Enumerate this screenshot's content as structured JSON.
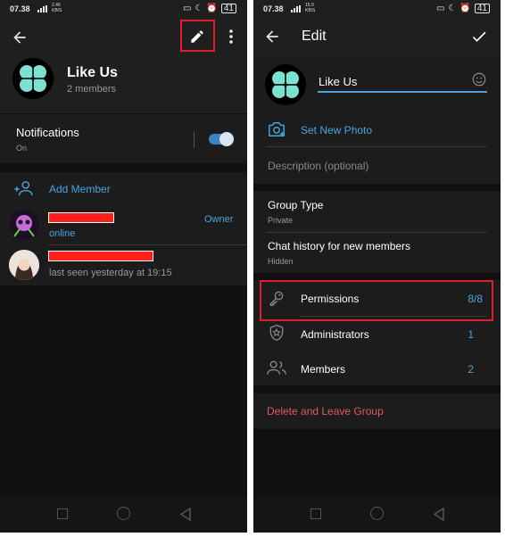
{
  "status": {
    "time": "07.38",
    "network_speed_top": "2.46",
    "network_speed_bottom": "KB/S",
    "network_speed_top_right": "15.9",
    "battery": "41"
  },
  "left": {
    "group_name": "Like Us",
    "members_count": "2 members",
    "notifications_label": "Notifications",
    "notifications_value": "On",
    "add_member": "Add Member",
    "members": [
      {
        "status": "online",
        "role": "Owner"
      },
      {
        "status": "last seen yesterday at 19:15",
        "role": ""
      }
    ]
  },
  "right": {
    "title": "Edit",
    "name_input": "Like Us",
    "set_new_photo": "Set New Photo",
    "description_placeholder": "Description (optional)",
    "group_type_label": "Group Type",
    "group_type_value": "Private",
    "chat_history_label": "Chat history for new members",
    "chat_history_value": "Hidden",
    "permissions_label": "Permissions",
    "permissions_value": "8/8",
    "administrators_label": "Administrators",
    "administrators_value": "1",
    "members_label": "Members",
    "members_value": "2",
    "delete_leave": "Delete and Leave Group"
  },
  "colors": {
    "accent": "#4aa3df",
    "danger": "#e05a5a",
    "avatar_clover": "#7ee0d0",
    "highlight_box": "#e01e2b"
  }
}
